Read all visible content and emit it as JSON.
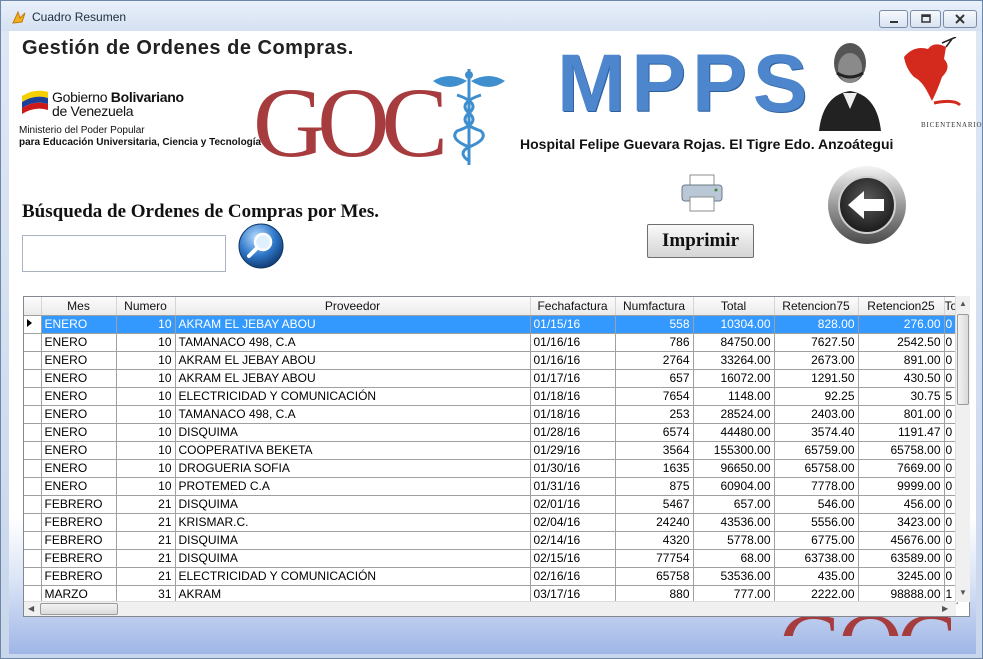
{
  "window": {
    "title": "Cuadro Resumen"
  },
  "header": {
    "app_title": "Gestión de Ordenes de Compras.",
    "gob_line1_prefix": "Gobierno ",
    "gob_line1_bold": "Bolivariano",
    "gob_line2": "de Venezuela",
    "ministry_line1": "Ministerio del Poder Popular",
    "ministry_line2": "para Educación Universitaria, Ciencia y Tecnología",
    "goc_text": "GOC",
    "mpps_text": "MPPS",
    "hospital": "Hospital Felipe Guevara Rojas. El Tigre Edo. Anzoátegui",
    "bicentenario": "BICENTENARIO"
  },
  "search": {
    "heading": "Búsqueda de Ordenes de Compras por Mes.",
    "input_value": "",
    "placeholder": ""
  },
  "actions": {
    "print_label": "Imprimir"
  },
  "grid": {
    "columns": [
      "Mes",
      "Numero",
      "Proveedor",
      "Fechafactura",
      "Numfactura",
      "Total",
      "Retencion75",
      "Retencion25",
      "To"
    ],
    "rows": [
      [
        "ENERO",
        "10",
        "AKRAM EL JEBAY ABOU",
        "01/15/16",
        "558",
        "10304.00",
        "828.00",
        "276.00",
        "0"
      ],
      [
        "ENERO",
        "10",
        "TAMANACO 498, C.A",
        "01/16/16",
        "786",
        "84750.00",
        "7627.50",
        "2542.50",
        "0"
      ],
      [
        "ENERO",
        "10",
        "AKRAM EL JEBAY ABOU",
        "01/16/16",
        "2764",
        "33264.00",
        "2673.00",
        "891.00",
        "0"
      ],
      [
        "ENERO",
        "10",
        "AKRAM EL JEBAY ABOU",
        "01/17/16",
        "657",
        "16072.00",
        "1291.50",
        "430.50",
        "0"
      ],
      [
        "ENERO",
        "10",
        "ELECTRICIDAD Y COMUNICACIÓN",
        "01/18/16",
        "7654",
        "1148.00",
        "92.25",
        "30.75",
        "5"
      ],
      [
        "ENERO",
        "10",
        "TAMANACO 498, C.A",
        "01/18/16",
        "253",
        "28524.00",
        "2403.00",
        "801.00",
        "0"
      ],
      [
        "ENERO",
        "10",
        "DISQUIMA",
        "01/28/16",
        "6574",
        "44480.00",
        "3574.40",
        "1191.47",
        "0"
      ],
      [
        "ENERO",
        "10",
        "COOPERATIVA BEKETA",
        "01/29/16",
        "3564",
        "155300.00",
        "65759.00",
        "65758.00",
        "0"
      ],
      [
        "ENERO",
        "10",
        "DROGUERIA SOFIA",
        "01/30/16",
        "1635",
        "96650.00",
        "65758.00",
        "7669.00",
        "0"
      ],
      [
        "ENERO",
        "10",
        "PROTEMED C.A",
        "01/31/16",
        "875",
        "60904.00",
        "7778.00",
        "9999.00",
        "0"
      ],
      [
        "FEBRERO",
        "21",
        "DISQUIMA",
        "02/01/16",
        "5467",
        "657.00",
        "546.00",
        "456.00",
        "0"
      ],
      [
        "FEBRERO",
        "21",
        "KRISMAR.C.",
        "02/04/16",
        "24240",
        "43536.00",
        "5556.00",
        "3423.00",
        "0"
      ],
      [
        "FEBRERO",
        "21",
        "DISQUIMA",
        "02/14/16",
        "4320",
        "5778.00",
        "6775.00",
        "45676.00",
        "0"
      ],
      [
        "FEBRERO",
        "21",
        "DISQUIMA",
        "02/15/16",
        "77754",
        "68.00",
        "63738.00",
        "63589.00",
        "0"
      ],
      [
        "FEBRERO",
        "21",
        "ELECTRICIDAD Y COMUNICACIÓN",
        "02/16/16",
        "65758",
        "53536.00",
        "435.00",
        "3245.00",
        "0"
      ],
      [
        "MARZO",
        "31",
        "AKRAM",
        "03/17/16",
        "880",
        "777.00",
        "2222.00",
        "98888.00",
        "1"
      ]
    ]
  },
  "colors": {
    "selection": "#3399ff",
    "goc_red": "#a73c3e",
    "mpps_blue": "#4d86cc"
  }
}
